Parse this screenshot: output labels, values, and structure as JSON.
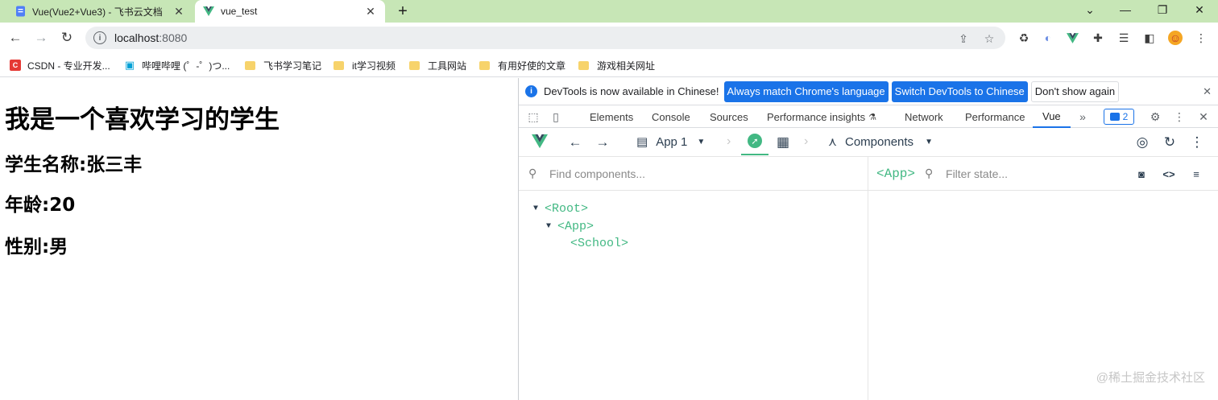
{
  "browser": {
    "tabs": [
      {
        "title": "Vue(Vue2+Vue3) - 飞书云文档",
        "active": false,
        "icon": "doc-icon"
      },
      {
        "title": "vue_test",
        "active": true,
        "icon": "vue-logo-icon"
      }
    ],
    "new_tab_glyph": "+",
    "url_host": "localhost",
    "url_port": ":8080",
    "bookmarks": [
      {
        "label": "CSDN - 专业开发...",
        "icon": "csdn-icon"
      },
      {
        "label": "哔哩哔哩 (゜-゜)つ...",
        "icon": "bilibili-icon"
      },
      {
        "label": "飞书学习笔记",
        "icon": "folder-icon"
      },
      {
        "label": "it学习视频",
        "icon": "folder-icon"
      },
      {
        "label": "工具网站",
        "icon": "folder-icon"
      },
      {
        "label": "有用好使的文章",
        "icon": "folder-icon"
      },
      {
        "label": "游戏相关网址",
        "icon": "folder-icon"
      }
    ]
  },
  "page": {
    "heading": "我是一个喜欢学习的学生",
    "name_line": "学生名称:张三丰",
    "age_line": "年龄:20",
    "gender_line": "性别:男"
  },
  "devtools": {
    "infobar": {
      "message": "DevTools is now available in Chinese!",
      "btn_match": "Always match Chrome's language",
      "btn_switch": "Switch DevTools to Chinese",
      "btn_dismiss": "Don't show again"
    },
    "tabs": [
      "Elements",
      "Console",
      "Sources",
      "Performance insights",
      "Network",
      "Performance",
      "Vue"
    ],
    "active_tab": "Vue",
    "issues_count": "2",
    "vue": {
      "app_selector": "App 1",
      "components_label": "Components",
      "find_placeholder": "Find components...",
      "filter_placeholder": "Filter state...",
      "selected_component": "<App>",
      "tree": [
        {
          "label": "<Root>",
          "depth": 0,
          "expanded": true
        },
        {
          "label": "<App>",
          "depth": 1,
          "expanded": true
        },
        {
          "label": "<School>",
          "depth": 2,
          "expanded": false
        }
      ]
    }
  },
  "watermark": "@稀土掘金技术社区",
  "colors": {
    "vue_green": "#42b883",
    "chrome_blue": "#1a73e8",
    "tabstrip": "#c7e6b6"
  }
}
